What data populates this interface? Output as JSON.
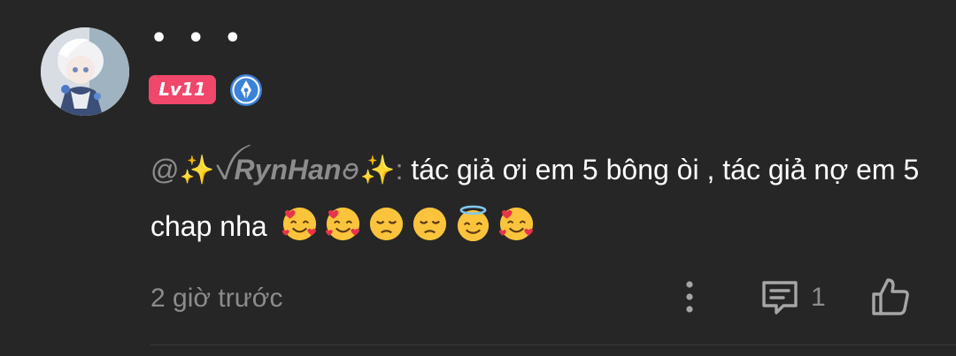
{
  "comment": {
    "username": "• • •",
    "level": "Lv11",
    "mention_prefix": "@✨ꪜ",
    "mention_name": "RynHan",
    "mention_suffix": "ꪮ✨:",
    "text": " tác giả ơi em 5 bông òi , tác giả nợ em 5 chap nha",
    "emojis": [
      "smiling-face-with-hearts",
      "smiling-face-with-hearts",
      "disappointed-face",
      "disappointed-face",
      "smiling-face-with-halo",
      "smiling-face-with-hearts"
    ],
    "timestamp": "2 giờ trước",
    "reply_count": "1"
  },
  "icons": {
    "author_badge": "pen-nib-badge-icon",
    "more": "vertical-dots-icon",
    "reply": "comment-bubble-icon",
    "like": "thumbs-up-icon"
  },
  "colors": {
    "background": "#262626",
    "level_badge": "#f0476a",
    "muted_text": "#8c8c8c",
    "author_badge": "#3b82d9"
  }
}
